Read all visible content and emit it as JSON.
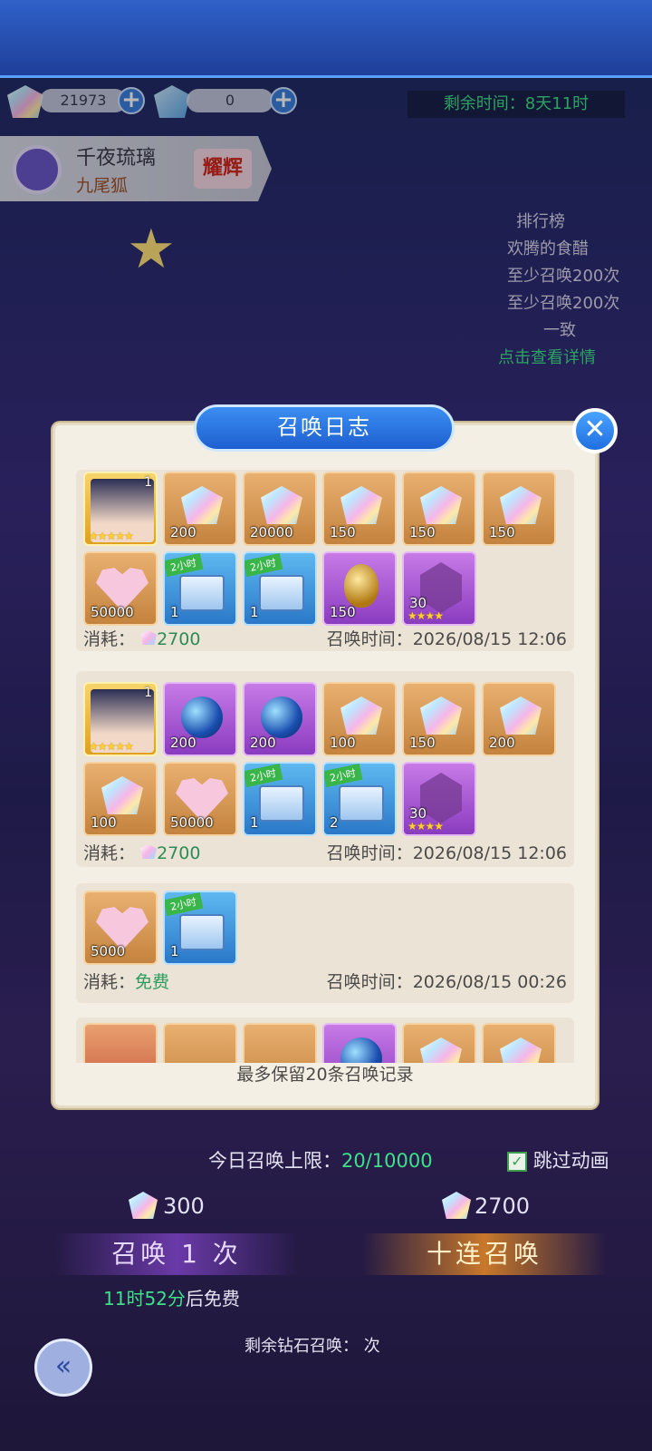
{
  "resources": {
    "gems": "21973",
    "fish": "0"
  },
  "event_timer": "剩余时间：8天11时",
  "hero": {
    "name": "千夜琉璃",
    "race": "九尾狐",
    "badge": "耀辉"
  },
  "ranking": {
    "title": "排行榜",
    "entries": [
      "欢腾的食醋",
      "至少召唤200次",
      "至少召唤200次"
    ],
    "note": "一致",
    "detail": "点击查看详情"
  },
  "modal": {
    "title": "召唤日志",
    "close": "✕",
    "footer": "最多保留20条召唤记录",
    "cost_label": "消耗：",
    "time_label": "召唤时间：",
    "records": [
      {
        "items": [
          "1",
          "200",
          "20000",
          "150",
          "150",
          "150",
          "50000",
          "1",
          "1",
          "150",
          "30"
        ],
        "cost": "2700",
        "time": "2026/08/15 12:06"
      },
      {
        "items": [
          "1",
          "200",
          "200",
          "100",
          "150",
          "200",
          "100",
          "50000",
          "1",
          "2",
          "30"
        ],
        "cost": "2700",
        "time": "2026/08/15 12:06"
      },
      {
        "items": [
          "5000",
          "1"
        ],
        "cost": "免费",
        "time": "2026/08/15 00:26"
      }
    ],
    "tag_2h": "2小时",
    "stars4": "★★★★",
    "stars5": "★★★★★"
  },
  "bottom": {
    "daily_limit_label": "今日召唤上限：",
    "daily_limit_value": "20/10000",
    "skip_anim": "跳过动画",
    "single_cost": "300",
    "ten_cost": "2700",
    "single_btn": "召唤 1 次",
    "ten_btn": "十连召唤",
    "free_timer": "11时52分",
    "free_suffix": "后免费",
    "remaining_label": "剩余钻石召唤：",
    "remaining_suffix": "次"
  }
}
